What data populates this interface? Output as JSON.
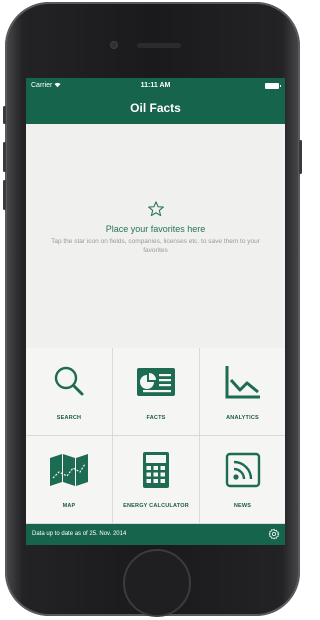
{
  "status_bar": {
    "carrier": "Carrier",
    "time": "11:11 AM"
  },
  "nav": {
    "title": "Oil Facts"
  },
  "favorites": {
    "title": "Place your favorites here",
    "description": "Tap the star icon on fields, companies, licenses etc. to save them to your favorites",
    "icon": "star-outline-icon"
  },
  "tiles": [
    {
      "label": "SEARCH",
      "icon": "search-icon"
    },
    {
      "label": "FACTS",
      "icon": "facts-card-icon"
    },
    {
      "label": "ANALYTICS",
      "icon": "line-chart-icon"
    },
    {
      "label": "MAP",
      "icon": "map-icon"
    },
    {
      "label": "ENERGY CALCULATOR",
      "icon": "calculator-icon"
    },
    {
      "label": "NEWS",
      "icon": "rss-feed-icon"
    }
  ],
  "footer": {
    "info": "Data up to date as of 25. Nov. 2014",
    "icon": "gear-icon"
  },
  "colors": {
    "brand_green": "#16644b",
    "icon_green": "#1d6b52",
    "background": "#f0f0ee"
  }
}
